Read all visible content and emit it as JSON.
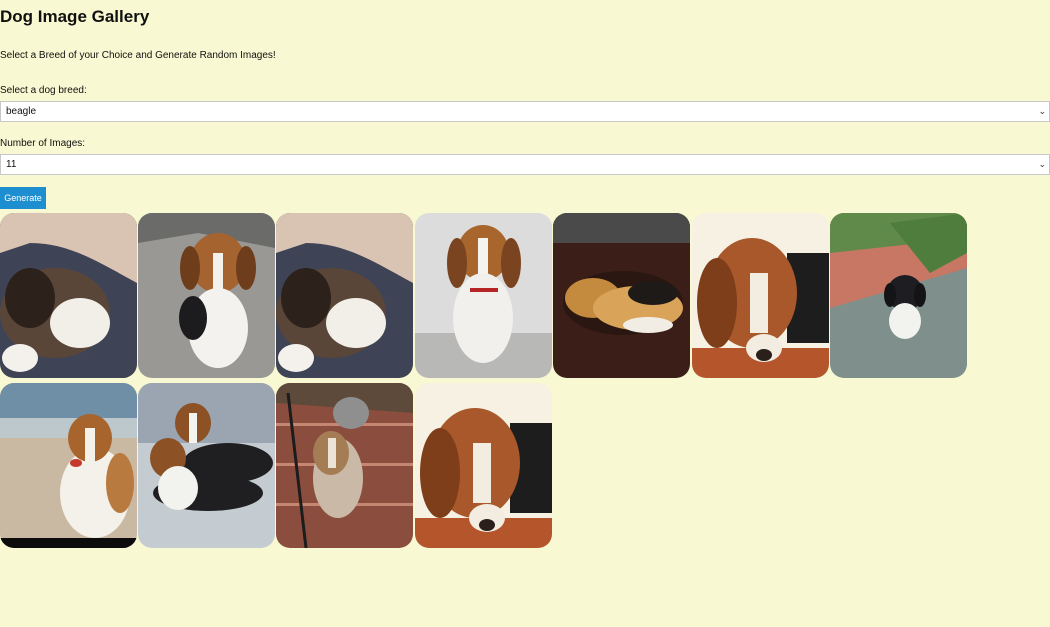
{
  "page": {
    "title": "Dog Image Gallery",
    "intro": "Select a Breed of your Choice and Generate Random Images!"
  },
  "breed": {
    "label": "Select a dog breed:",
    "selected": "beagle",
    "chevron_icon": "chevron-down-icon"
  },
  "count": {
    "label": "Number of Images:",
    "selected": "11",
    "chevron_icon": "chevron-down-icon"
  },
  "generate_button": {
    "label": "Generate",
    "color": "#1d8fd1"
  },
  "colors": {
    "background": "#f8f8d2"
  },
  "gallery": {
    "image_count": 11
  }
}
